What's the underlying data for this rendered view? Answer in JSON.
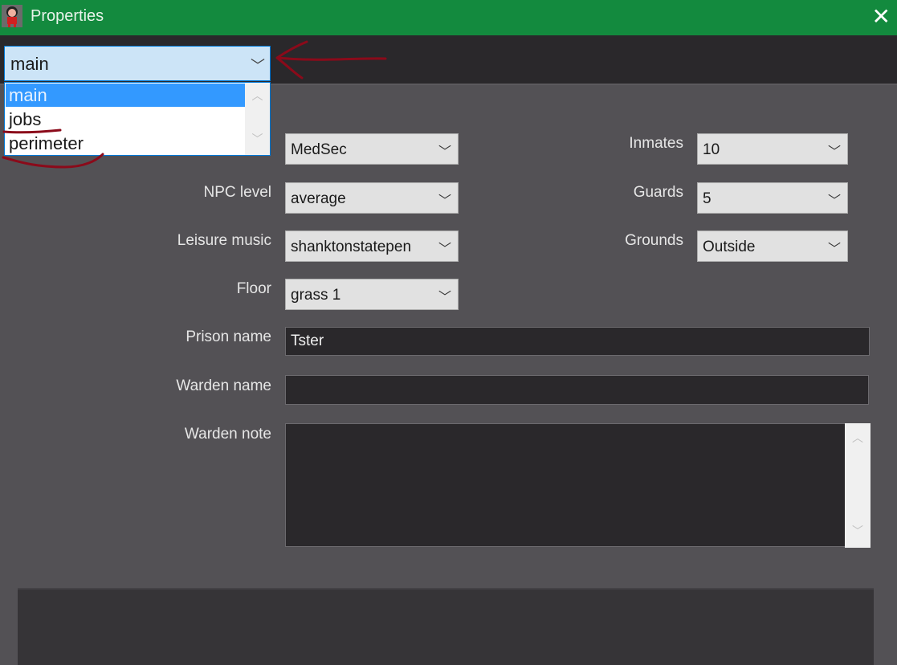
{
  "window": {
    "title": "Properties",
    "close_icon": "close-icon"
  },
  "section_combo": {
    "value": "main",
    "options": [
      "main",
      "jobs",
      "perimeter"
    ]
  },
  "fields_left": [
    {
      "label": "",
      "value": "MedSec"
    },
    {
      "label": "NPC level",
      "value": "average"
    },
    {
      "label": "Leisure music",
      "value": "shanktonstatepen"
    },
    {
      "label": "Floor",
      "value": "grass 1"
    }
  ],
  "fields_right": [
    {
      "label": "Inmates",
      "value": "10"
    },
    {
      "label": "Guards",
      "value": "5"
    },
    {
      "label": "Grounds",
      "value": "Outside"
    }
  ],
  "prison_name": {
    "label": "Prison name",
    "value": "Tster"
  },
  "warden_name": {
    "label": "Warden name",
    "value": ""
  },
  "warden_note": {
    "label": "Warden note",
    "value": ""
  },
  "colors": {
    "titlebar": "#138a3e",
    "annotation": "#8b0a1a",
    "selection": "#3399ff"
  }
}
